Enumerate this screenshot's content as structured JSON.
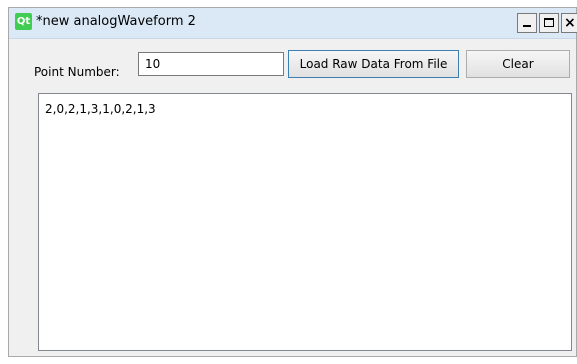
{
  "window": {
    "title": "*new analogWaveform 2",
    "logo_text": "Qt",
    "controls": {
      "minimize": "_",
      "maximize": "□",
      "close": "×"
    }
  },
  "form": {
    "point_number_label": "Point Number:",
    "point_number_value": "10",
    "load_button_label": "Load Raw Data From File",
    "clear_button_label": "Clear",
    "raw_data_text": "2,0,2,1,3,1,0,2,1,3"
  }
}
